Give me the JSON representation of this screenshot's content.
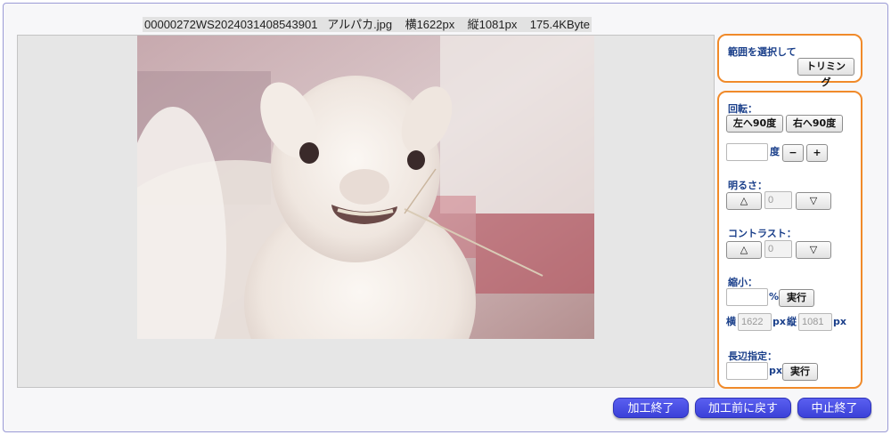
{
  "file_info": "00000272WS2024031408543901   アルパカ.jpg    横1622px    縦1081px    175.4KByte",
  "trim_panel": {
    "label": "範囲を選択して",
    "trim_button": "トリミング"
  },
  "rotate": {
    "label": "回転：",
    "left_button": "左へ90度",
    "right_button": "右へ90度",
    "degree_value": "",
    "degree_unit": "度",
    "minus_button": "−",
    "plus_button": "+"
  },
  "brightness": {
    "label": "明るさ：",
    "up_button": "△",
    "value": "0",
    "down_button": "▽"
  },
  "contrast": {
    "label": "コントラスト：",
    "up_button": "△",
    "value": "0",
    "down_button": "▽"
  },
  "shrink": {
    "label": "縮小：",
    "percent_value": "",
    "percent_unit": "%",
    "run_button": "実行",
    "width_label": "横",
    "width_value": "1622",
    "width_unit": "px",
    "height_label": "縦",
    "height_value": "1081",
    "height_unit": "px"
  },
  "long_side": {
    "label": "長辺指定：",
    "value": "",
    "unit": "px",
    "run_button": "実行"
  },
  "actions": {
    "finish": "加工終了",
    "revert": "加工前に戻す",
    "cancel": "中止終了"
  },
  "colors": {
    "accent_border": "#f08a2a",
    "label_text": "#1a3f8a",
    "action_button": "#4a4fe6"
  }
}
